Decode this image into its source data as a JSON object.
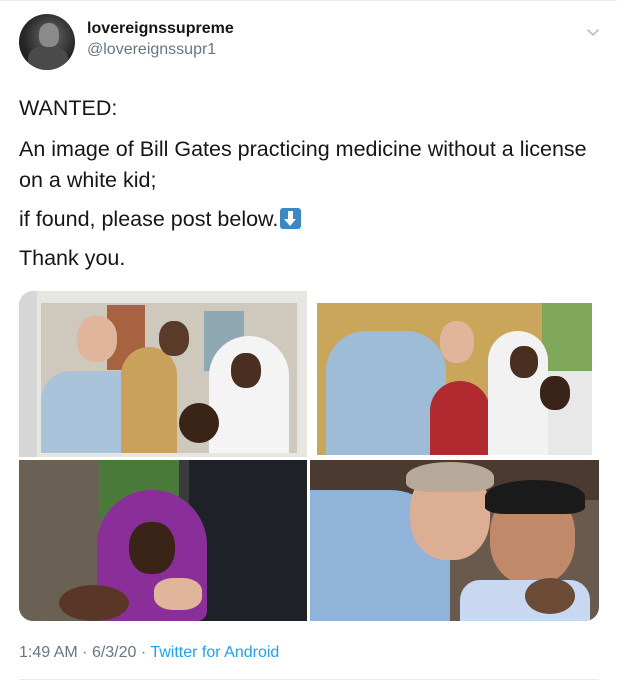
{
  "tweet": {
    "display_name": "lovereignssupreme",
    "handle": "@lovereignssupr1",
    "lines": [
      "WANTED:",
      "An image of Bill Gates practicing medicine without a license on a white kid;",
      "if found, please post below.",
      "Thank you."
    ],
    "emoji_icon": "down-arrow-emoji-icon",
    "time": "1:49 AM",
    "separator": "·",
    "date": "6/3/20",
    "source": "Twitter for Android"
  },
  "colors": {
    "text": "#14171a",
    "secondary": "#657786",
    "link": "#1da1f2",
    "border": "#e6ecf0",
    "emoji_blue": "#3b88c3"
  }
}
